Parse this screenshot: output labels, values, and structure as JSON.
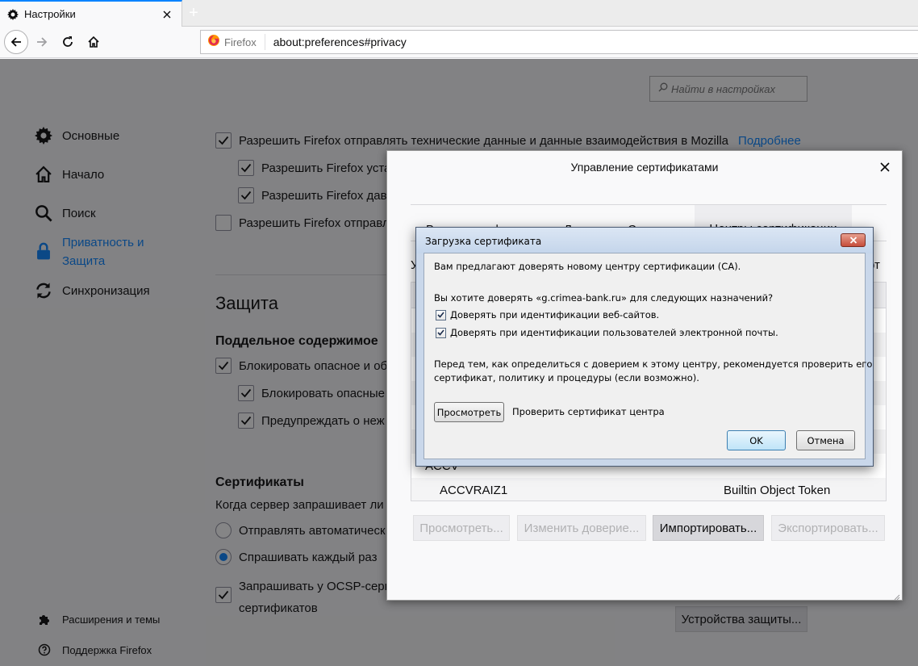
{
  "browser": {
    "tab_title": "Настройки",
    "new_tab": "+",
    "identity_label": "Firefox",
    "url": "about:preferences#privacy"
  },
  "prefs": {
    "search_placeholder": "Найти в настройках",
    "categories": [
      {
        "label": "Основные"
      },
      {
        "label": "Начало"
      },
      {
        "label": "Поиск"
      },
      {
        "label_line1": "Приватность и",
        "label_line2": "Защита"
      },
      {
        "label": "Синхронизация"
      }
    ],
    "footer_links": {
      "extensions": "Расширения и темы",
      "support": "Поддержка Firefox"
    },
    "data_collection": {
      "main": "Разрешить Firefox отправлять технические данные и данные взаимодействия в Mozilla",
      "learn_more": "Подробнее",
      "sub1": "Разрешить Firefox уста",
      "sub2": "Разрешить Firefox дава",
      "main2": "Разрешить Firefox отправл"
    },
    "security": {
      "heading": "Защита",
      "deceptive_heading": "Поддельное содержимое",
      "block1": "Блокировать опасное и об",
      "block2": "Блокировать опасные",
      "warn": "Предупреждать о неж"
    },
    "certificates": {
      "heading": "Сертификаты",
      "desc": "Когда сервер запрашивает ли",
      "radio_auto": "Отправлять автоматическ",
      "radio_ask": "Спрашивать каждый раз",
      "ocsp_line1": "Запрашивать у OCSP-серве",
      "ocsp_line2": "сертификатов",
      "devices_button": "Устройства защиты..."
    }
  },
  "cert_manager": {
    "title": "Управление сертификатами",
    "tabs": [
      "Ваши сертификаты",
      "Люди",
      "Серверы",
      "Центры сертификации"
    ],
    "desc_left": "У",
    "desc_right": "рт",
    "rows": [
      {
        "name": "ACCV",
        "token": ""
      },
      {
        "name": "ACCVRAIZ1",
        "token": "Builtin Object Token"
      }
    ],
    "buttons": {
      "view": "Просмотреть...",
      "edit": "Изменить доверие...",
      "import": "Импортировать...",
      "export": "Экспортировать..."
    }
  },
  "download_cert": {
    "title": "Загрузка сертификата",
    "line1": "Вам предлагают доверять новому центру сертификации (CA).",
    "question": "Вы хотите доверять «g.crimea-bank.ru» для следующих назначений?",
    "trust_web": "Доверять при идентификации веб-сайтов.",
    "trust_email": "Доверять при идентификации пользователей электронной почты.",
    "advice_line1": "Перед тем, как определиться с доверием к этому центру, рекомендуется проверить его",
    "advice_line2": "сертификат, политику и процедуры (если возможно).",
    "view_button": "Просмотреть",
    "view_caption": "Проверить сертификат центра",
    "ok": "OK",
    "cancel": "Отмена"
  },
  "colors": {
    "accent": "#0a84ff",
    "shade": "rgba(12,12,13,0.5)"
  }
}
